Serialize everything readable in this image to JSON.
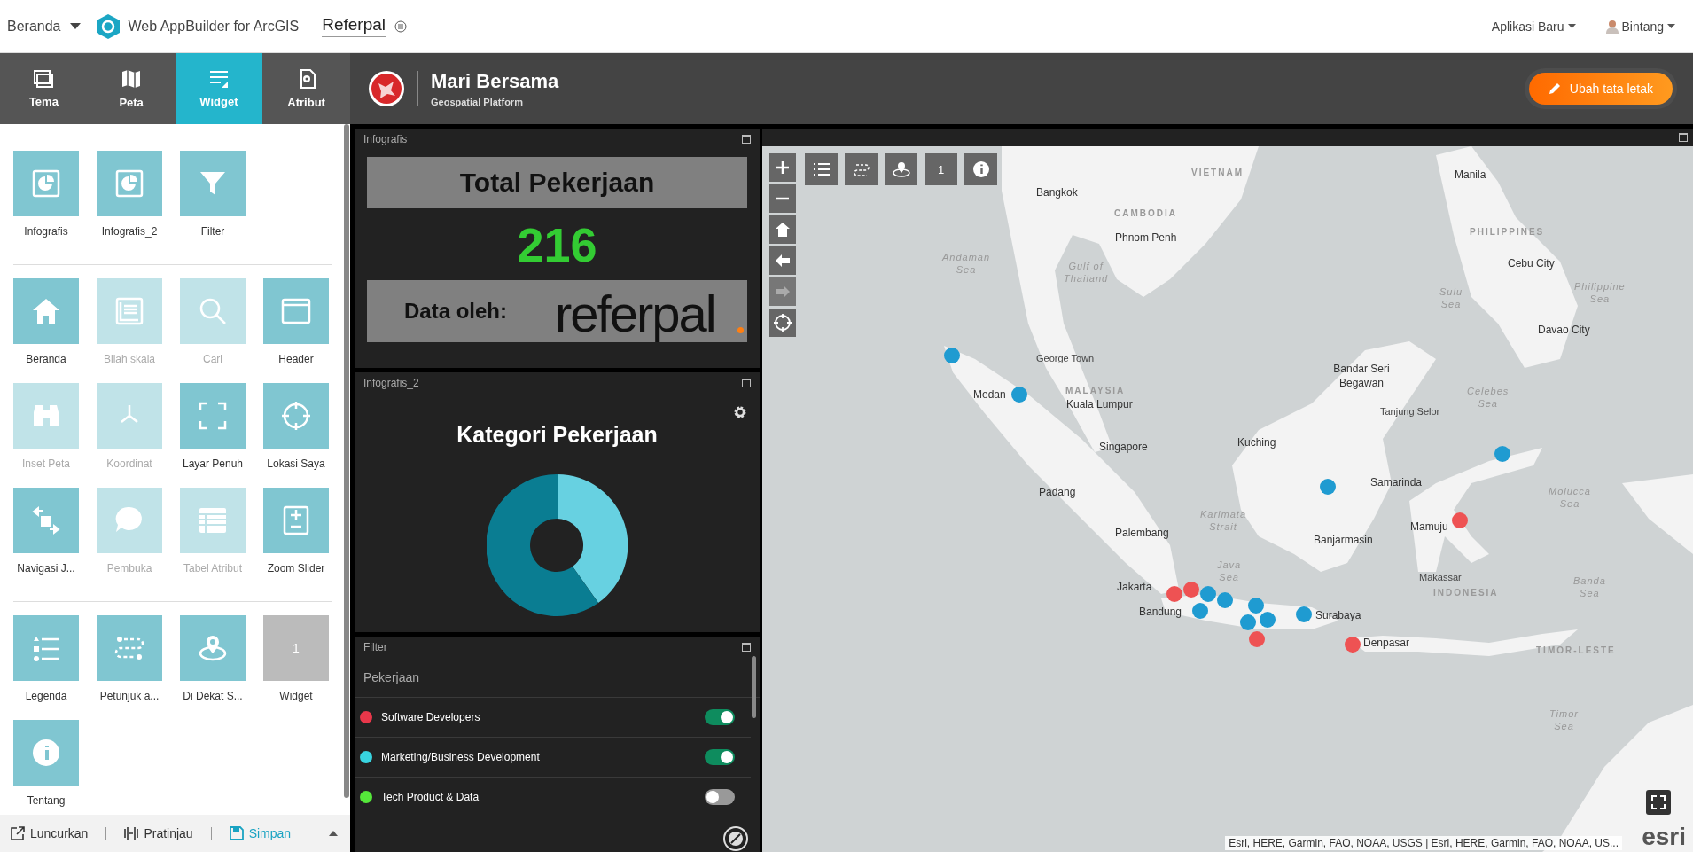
{
  "top_bar": {
    "home": "Beranda",
    "product": "Web AppBuilder for ArcGIS",
    "app_name": "Referpal",
    "new_app": "Aplikasi Baru",
    "user": "Bintang"
  },
  "builder_tabs": [
    {
      "label": "Tema",
      "selected": false
    },
    {
      "label": "Peta",
      "selected": false
    },
    {
      "label": "Widget",
      "selected": true
    },
    {
      "label": "Atribut",
      "selected": false
    }
  ],
  "widget_sections": [
    {
      "items": [
        {
          "label": "Infografis",
          "kind": "widget",
          "disabled": false
        },
        {
          "label": "Infografis_2",
          "kind": "widget",
          "disabled": false
        },
        {
          "label": "Filter",
          "kind": "widget",
          "disabled": false
        }
      ]
    },
    {
      "items": [
        {
          "label": "Beranda",
          "kind": "widget",
          "disabled": false
        },
        {
          "label": "Bilah skala",
          "kind": "widget",
          "disabled": true
        },
        {
          "label": "Cari",
          "kind": "widget",
          "disabled": true
        },
        {
          "label": "Header",
          "kind": "widget",
          "disabled": false
        },
        {
          "label": "Inset Peta",
          "kind": "widget",
          "disabled": true
        },
        {
          "label": "Koordinat",
          "kind": "widget",
          "disabled": true
        },
        {
          "label": "Layar Penuh",
          "kind": "widget",
          "disabled": false
        },
        {
          "label": "Lokasi Saya",
          "kind": "widget",
          "disabled": false
        },
        {
          "label": "Navigasi J...",
          "kind": "widget",
          "disabled": false
        },
        {
          "label": "Pembuka",
          "kind": "widget",
          "disabled": true
        },
        {
          "label": "Tabel Atribut",
          "kind": "widget",
          "disabled": true
        },
        {
          "label": "Zoom Slider",
          "kind": "widget",
          "disabled": false
        }
      ]
    },
    {
      "items": [
        {
          "label": "Legenda",
          "kind": "widget",
          "disabled": false
        },
        {
          "label": "Petunjuk a...",
          "kind": "widget",
          "disabled": false
        },
        {
          "label": "Di Dekat S...",
          "kind": "widget",
          "disabled": false
        },
        {
          "label": "Widget",
          "kind": "placeholder",
          "text": "1",
          "disabled": false
        },
        {
          "label": "Tentang",
          "kind": "widget",
          "disabled": false
        }
      ]
    }
  ],
  "bottom_bar": {
    "launch": "Luncurkan",
    "preview": "Pratinjau",
    "save": "Simpan"
  },
  "app_header": {
    "title": "Mari Bersama",
    "subtitle": "Geospatial Platform",
    "edit_button": "Ubah tata letak"
  },
  "infografis": {
    "title": "Infografis",
    "heading": "Total Pekerjaan",
    "value": "216",
    "credit": "Data oleh:",
    "logo_text": "referpal"
  },
  "infografis_2": {
    "title": "Infografis_2",
    "heading": "Kategori Pekerjaan"
  },
  "filter": {
    "title": "Filter",
    "group": "Pekerjaan",
    "items": [
      {
        "label": "Software Developers",
        "color": "#e8374a",
        "on": true
      },
      {
        "label": "Marketing/Business Development",
        "color": "#38d4e0",
        "on": true
      },
      {
        "label": "Tech Product & Data",
        "color": "#55e83a",
        "on": false
      }
    ]
  },
  "map": {
    "toolbar_badge": "1",
    "forward_disabled": true,
    "labels": [
      {
        "text": "VIETNAM",
        "kind": "country"
      },
      {
        "text": "Manila",
        "kind": "city"
      },
      {
        "text": "Bangkok",
        "kind": "city"
      },
      {
        "text": "CAMBODIA",
        "kind": "country"
      },
      {
        "text": "Phnom Penh",
        "kind": "city"
      },
      {
        "text": "PHILIPPINES",
        "kind": "country"
      },
      {
        "text": "Andaman Sea",
        "kind": "sea"
      },
      {
        "text": "Gulf of Thailand",
        "kind": "sea"
      },
      {
        "text": "Cebu City",
        "kind": "city"
      },
      {
        "text": "Sulu Sea",
        "kind": "sea"
      },
      {
        "text": "Philippine Sea",
        "kind": "sea"
      },
      {
        "text": "Davao City",
        "kind": "city"
      },
      {
        "text": "George Town",
        "kind": "town"
      },
      {
        "text": "Bandar Seri Begawan",
        "kind": "city"
      },
      {
        "text": "Medan",
        "kind": "city"
      },
      {
        "text": "MALAYSIA",
        "kind": "country"
      },
      {
        "text": "Kuala Lumpur",
        "kind": "city"
      },
      {
        "text": "Tanjung Selor",
        "kind": "town"
      },
      {
        "text": "Celebes Sea",
        "kind": "sea"
      },
      {
        "text": "Singapore",
        "kind": "city"
      },
      {
        "text": "Kuching",
        "kind": "city"
      },
      {
        "text": "Padang",
        "kind": "city"
      },
      {
        "text": "Samarinda",
        "kind": "city"
      },
      {
        "text": "Molucca Sea",
        "kind": "sea"
      },
      {
        "text": "Palembang",
        "kind": "city"
      },
      {
        "text": "Karimata Strait",
        "kind": "sea"
      },
      {
        "text": "Banjarmasin",
        "kind": "city"
      },
      {
        "text": "Mamuju",
        "kind": "city"
      },
      {
        "text": "Jakarta",
        "kind": "city"
      },
      {
        "text": "Java Sea",
        "kind": "sea"
      },
      {
        "text": "Makassar",
        "kind": "town"
      },
      {
        "text": "INDONESIA",
        "kind": "country"
      },
      {
        "text": "Banda Sea",
        "kind": "sea"
      },
      {
        "text": "Bandung",
        "kind": "city"
      },
      {
        "text": "Surabaya",
        "kind": "city"
      },
      {
        "text": "Denpasar",
        "kind": "city"
      },
      {
        "text": "TIMOR-LESTE",
        "kind": "country"
      },
      {
        "text": "Timor Sea",
        "kind": "sea"
      }
    ],
    "points": [
      {
        "color": "#1f9bd1"
      },
      {
        "color": "#1f9bd1"
      },
      {
        "color": "#1f9bd1"
      },
      {
        "color": "#1f9bd1"
      },
      {
        "color": "#ee5253"
      },
      {
        "color": "#ee5253"
      },
      {
        "color": "#ee5253"
      },
      {
        "color": "#1f9bd1"
      },
      {
        "color": "#1f9bd1"
      },
      {
        "color": "#1f9bd1"
      },
      {
        "color": "#1f9bd1"
      },
      {
        "color": "#1f9bd1"
      },
      {
        "color": "#1f9bd1"
      },
      {
        "color": "#ee5253"
      },
      {
        "color": "#1f9bd1"
      },
      {
        "color": "#ee5253"
      }
    ],
    "attribution": "Esri, HERE, Garmin, FAO, NOAA, USGS | Esri, HERE, Garmin, FAO, NOAA, US...",
    "brand": "esri"
  }
}
